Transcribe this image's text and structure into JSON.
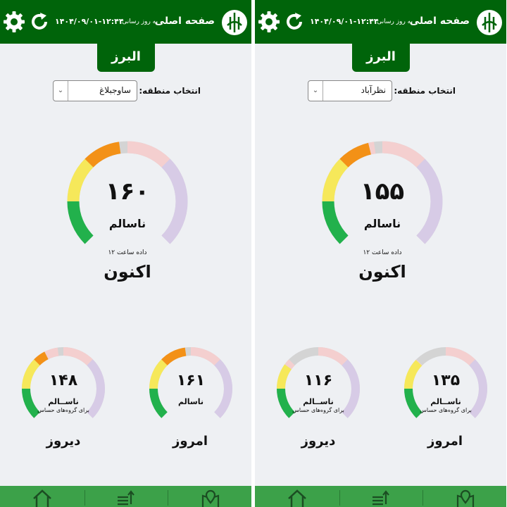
{
  "screens": [
    {
      "header": {
        "home_title": "صفحه اصلی",
        "update_label": "به روز رسانی:",
        "update_date": "۱۴۰۴/۰۹/۰۱-۱۲:۴۴"
      },
      "province": "البرز",
      "region": {
        "label": "انتخاب منطقه:",
        "value": "ساوجبلاغ"
      },
      "main_gauge": {
        "value": "۱۶۰",
        "status": "ناسالم",
        "data_hour": "داده ساعت ۱۲",
        "label": "اکنون",
        "fraction": 0.47
      },
      "today_gauge": {
        "value": "۱۶۱",
        "status": "ناسالم",
        "sub": "",
        "label": "امروز",
        "fraction": 0.47
      },
      "yesterday_gauge": {
        "value": "۱۴۸",
        "status": "ناســالم",
        "sub": "برای گروه‌های حساس",
        "label": "دیروز",
        "fraction": 0.4
      }
    },
    {
      "header": {
        "home_title": "صفحه اصلی",
        "update_label": "به روز رسانی:",
        "update_date": "۱۴۰۴/۰۹/۰۱-۱۲:۴۴"
      },
      "province": "البرز",
      "region": {
        "label": "انتخاب منطقه:",
        "value": "نظرآباد"
      },
      "main_gauge": {
        "value": "۱۵۵",
        "status": "ناسالم",
        "data_hour": "داده ساعت ۱۲",
        "label": "اکنون",
        "fraction": 0.45
      },
      "today_gauge": {
        "value": "۱۳۵",
        "status": "ناســالم",
        "sub": "برای گروه‌های حساس",
        "label": "امروز",
        "fraction": 0.33
      },
      "yesterday_gauge": {
        "value": "۱۱۶",
        "status": "ناســالم",
        "sub": "برای گروه‌های حساس",
        "label": "دیروز",
        "fraction": 0.3
      }
    }
  ],
  "colors": {
    "header": "#00640a",
    "nav": "#3ca149",
    "good": "#22b14c",
    "moderate": "#f6e85a",
    "sensitive": "#f39117",
    "unhealthy": "#e8221b",
    "very_unhealthy": "#f4cfcf",
    "hazardous": "#d7cbe6",
    "track": "#d4d4d4"
  },
  "icons": {
    "settings": "gear-icon",
    "refresh": "refresh-icon",
    "logo": "doe-logo-icon",
    "home": "home-icon",
    "list": "list-icon",
    "map": "map-pin-icon"
  }
}
